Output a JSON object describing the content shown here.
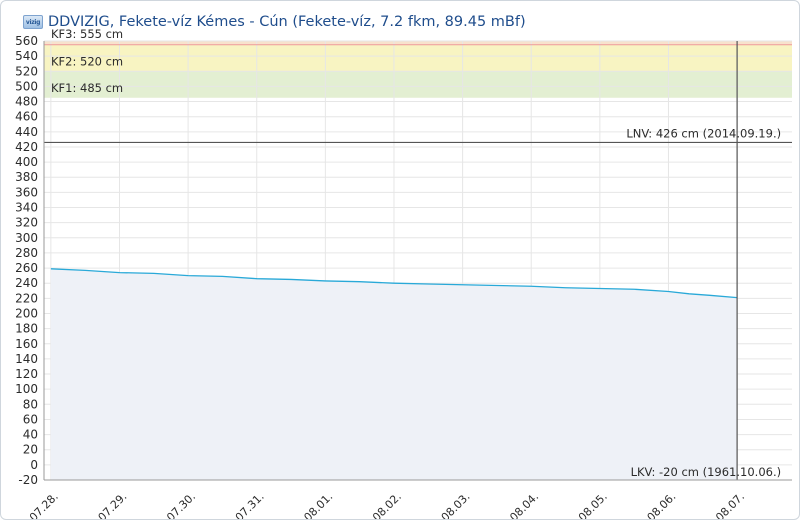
{
  "header": {
    "logo_text": "vizig",
    "title": "DDVIZIG, Fekete-víz Kémes - Cún (Fekete-víz, 7.2 fkm, 89.45 mBf)"
  },
  "colors": {
    "line": "#29a9d8",
    "area_fill": "#eef1f7",
    "band_kf3": "#f8e2cc",
    "band_kf2": "#f8f4c2",
    "band_kf1": "#e3efd2",
    "kf3_line": "#ee9a99",
    "ref_line": "#555555",
    "grid": "#e6e6e6"
  },
  "chart_data": {
    "type": "area",
    "title": "DDVIZIG, Fekete-víz Kémes - Cún (Fekete-víz, 7.2 fkm, 89.45 mBf)",
    "xlabel": "",
    "ylabel": "",
    "ylim": [
      -20,
      560
    ],
    "y_ticks": [
      -20,
      0,
      20,
      40,
      60,
      80,
      100,
      120,
      140,
      160,
      180,
      200,
      220,
      240,
      260,
      280,
      300,
      320,
      340,
      360,
      380,
      400,
      420,
      440,
      460,
      480,
      500,
      520,
      540,
      560
    ],
    "x_ticks": [
      "07.28.",
      "07.29.",
      "07.30.",
      "07.31.",
      "08.01.",
      "08.02.",
      "08.03.",
      "08.04.",
      "08.05.",
      "08.06.",
      "08.07."
    ],
    "grid": true,
    "legend": "none",
    "series": [
      {
        "x": [
          0,
          0.5,
          1,
          1.5,
          2,
          2.5,
          3,
          3.5,
          4,
          4.5,
          5,
          5.5,
          6,
          6.5,
          7,
          7.5,
          8,
          8.5,
          9,
          9.3,
          9.6,
          10
        ],
        "values": [
          259,
          257,
          254,
          253,
          250,
          249,
          246,
          245,
          243,
          242,
          240,
          239,
          238,
          237,
          236,
          234,
          233,
          232,
          229,
          226,
          224,
          221
        ]
      }
    ],
    "bands": [
      {
        "label": "KF3: 555 cm",
        "from": 555,
        "to": 560
      },
      {
        "label": "KF2: 520 cm",
        "from": 520,
        "to": 555
      },
      {
        "label": "KF1: 485 cm",
        "from": 485,
        "to": 520
      }
    ],
    "reference_lines": [
      {
        "label": "LNV: 426 cm (2014.09.19.)",
        "value": 426
      },
      {
        "label": "LKV: -20 cm (1961.10.06.)",
        "value": -20
      }
    ],
    "current_x": 10
  }
}
